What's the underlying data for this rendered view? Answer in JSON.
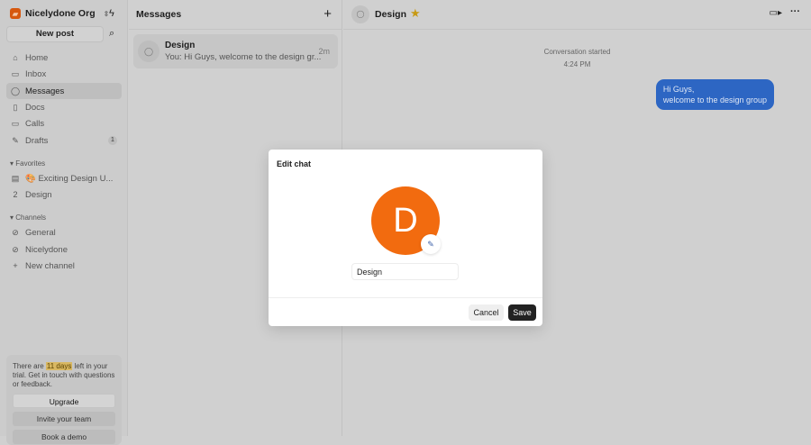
{
  "sidebar": {
    "org": "Nicelydone Org",
    "new_post": "New post",
    "nav": [
      {
        "label": "Home",
        "icon": "⌂"
      },
      {
        "label": "Inbox",
        "icon": "▭"
      },
      {
        "label": "Messages",
        "icon": "◯"
      },
      {
        "label": "Docs",
        "icon": "▯"
      },
      {
        "label": "Calls",
        "icon": "▭"
      },
      {
        "label": "Drafts",
        "icon": "✎",
        "badge": "1"
      }
    ],
    "favorites_label": "Favorites",
    "favorites": [
      {
        "label": "🎨 Exciting Design U...",
        "icon": "▤"
      },
      {
        "label": "Design",
        "icon": "2"
      }
    ],
    "channels_label": "Channels",
    "channels": [
      {
        "label": "General"
      },
      {
        "label": "Nicelydone"
      }
    ],
    "new_channel": "New channel",
    "trial": {
      "pre": "There are ",
      "days": "11 days",
      "post": " left in your trial. Get in touch with questions or feedback.",
      "upgrade": "Upgrade",
      "invite": "Invite your team",
      "demo": "Book a demo"
    }
  },
  "messages": {
    "title": "Messages",
    "conversation": {
      "name": "Design",
      "preview": "You: Hi Guys, welcome to the design gr...",
      "time": "2m"
    }
  },
  "chat": {
    "title": "Design",
    "started": "Conversation started",
    "time": "4:24 PM",
    "message_line1": "Hi Guys,",
    "message_line2": "welcome to the design group"
  },
  "modal": {
    "title": "Edit chat",
    "avatar_letter": "D",
    "name_value": "Design",
    "cancel": "Cancel",
    "save": "Save"
  },
  "colors": {
    "accent": "#f26b0f",
    "bubble": "#2d66c3"
  }
}
